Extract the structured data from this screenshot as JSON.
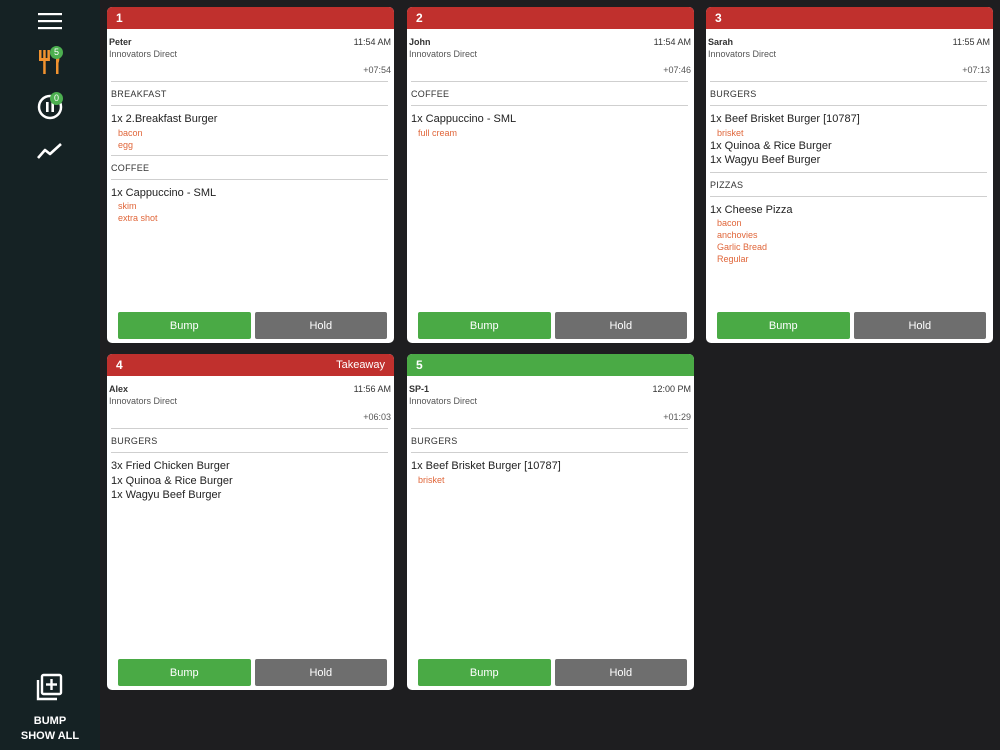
{
  "sidebar": {
    "menu_icon": "hamburger-menu-icon",
    "orders_badge": "5",
    "hold_badge": "0",
    "bump_label": "BUMP",
    "show_all_label": "SHOW ALL"
  },
  "tickets": [
    {
      "number": "1",
      "tag": "",
      "header_color": "#c0302d",
      "name": "Peter",
      "time": "11:54 AM",
      "company": "Innovators Direct",
      "elapsed": "+07:54",
      "sections": [
        {
          "title": "BREAKFAST",
          "items": [
            {
              "label": "1x 2.Breakfast Burger",
              "mods": [
                "bacon",
                "egg"
              ]
            }
          ]
        },
        {
          "title": "COFFEE",
          "items": [
            {
              "label": "1x Cappuccino - SML",
              "mods": [
                "skim",
                "extra shot"
              ]
            }
          ]
        }
      ],
      "bump_label": "Bump",
      "hold_label": "Hold"
    },
    {
      "number": "2",
      "tag": "",
      "header_color": "#c0302d",
      "name": "John",
      "time": "11:54 AM",
      "company": "Innovators Direct",
      "elapsed": "+07:46",
      "sections": [
        {
          "title": "COFFEE",
          "items": [
            {
              "label": "1x Cappuccino - SML",
              "mods": [
                "full cream"
              ]
            }
          ]
        }
      ],
      "bump_label": "Bump",
      "hold_label": "Hold"
    },
    {
      "number": "3",
      "tag": "",
      "header_color": "#c0302d",
      "name": "Sarah",
      "time": "11:55 AM",
      "company": "Innovators Direct",
      "elapsed": "+07:13",
      "sections": [
        {
          "title": "BURGERS",
          "items": [
            {
              "label": "1x Beef Brisket Burger [10787]",
              "mods": [
                "brisket"
              ]
            },
            {
              "label": "1x Quinoa & Rice Burger",
              "mods": []
            },
            {
              "label": "1x Wagyu Beef Burger",
              "mods": []
            }
          ]
        },
        {
          "title": "PIZZAS",
          "items": [
            {
              "label": "1x Cheese Pizza",
              "mods": [
                "bacon",
                "anchovies",
                "Garlic Bread",
                "Regular"
              ]
            }
          ]
        }
      ],
      "bump_label": "Bump",
      "hold_label": "Hold"
    },
    {
      "number": "4",
      "tag": "Takeaway",
      "header_color": "#c0302d",
      "name": "Alex",
      "time": "11:56 AM",
      "company": "Innovators Direct",
      "elapsed": "+06:03",
      "sections": [
        {
          "title": "BURGERS",
          "items": [
            {
              "label": "3x Fried Chicken Burger",
              "mods": []
            },
            {
              "label": "1x Quinoa & Rice Burger",
              "mods": []
            },
            {
              "label": "1x Wagyu Beef Burger",
              "mods": []
            }
          ]
        }
      ],
      "bump_label": "Bump",
      "hold_label": "Hold"
    },
    {
      "number": "5",
      "tag": "",
      "header_color": "#4aaa45",
      "name": "SP-1",
      "time": "12:00 PM",
      "company": "Innovators Direct",
      "elapsed": "+01:29",
      "sections": [
        {
          "title": "BURGERS",
          "items": [
            {
              "label": "1x Beef Brisket Burger [10787]",
              "mods": [
                "brisket"
              ]
            }
          ]
        }
      ],
      "bump_label": "Bump",
      "hold_label": "Hold"
    }
  ]
}
